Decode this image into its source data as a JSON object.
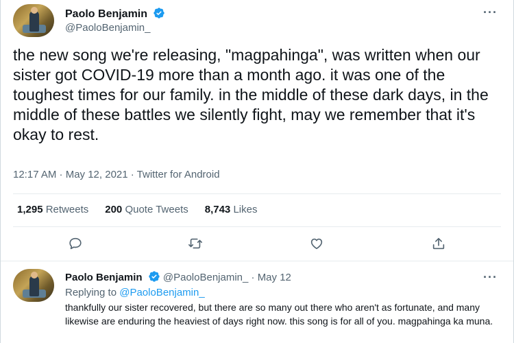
{
  "tweet": {
    "author_name": "Paolo Benjamin",
    "author_handle": "@PaoloBenjamin_",
    "more_label": "···",
    "text": "the new song we're releasing, \"magpahinga\", was written when our sister got COVID-19 more than a month ago. it was one of the toughest times for our family. in the middle of these dark days, in the middle of these battles we silently fight, may we remember that it's okay to rest.",
    "timestamp": "12:17 AM · May 12, 2021 · Twitter for Android",
    "stats": [
      {
        "count": "1,295",
        "label": "Retweets"
      },
      {
        "count": "200",
        "label": "Quote Tweets"
      },
      {
        "count": "8,743",
        "label": "Likes"
      }
    ],
    "actions": [
      {
        "icon": "reply-icon"
      },
      {
        "icon": "retweet-icon"
      },
      {
        "icon": "like-icon"
      },
      {
        "icon": "share-icon"
      }
    ]
  },
  "reply": {
    "author_name": "Paolo Benjamin",
    "author_handle": "@PaoloBenjamin_",
    "date": "May 12",
    "more_label": "···",
    "replying_prefix": "Replying to",
    "replying_to": "@PaoloBenjamin_",
    "text": "thankfully our sister recovered, but there are so many out there who aren't as fortunate, and many likewise are enduring the heaviest of days right now. this song is for all of you. magpahinga ka muna."
  },
  "colors": {
    "verified": "#1d9bf0",
    "link": "#1d9bf0",
    "secondary_text": "#536471",
    "primary_text": "#0f1419"
  }
}
